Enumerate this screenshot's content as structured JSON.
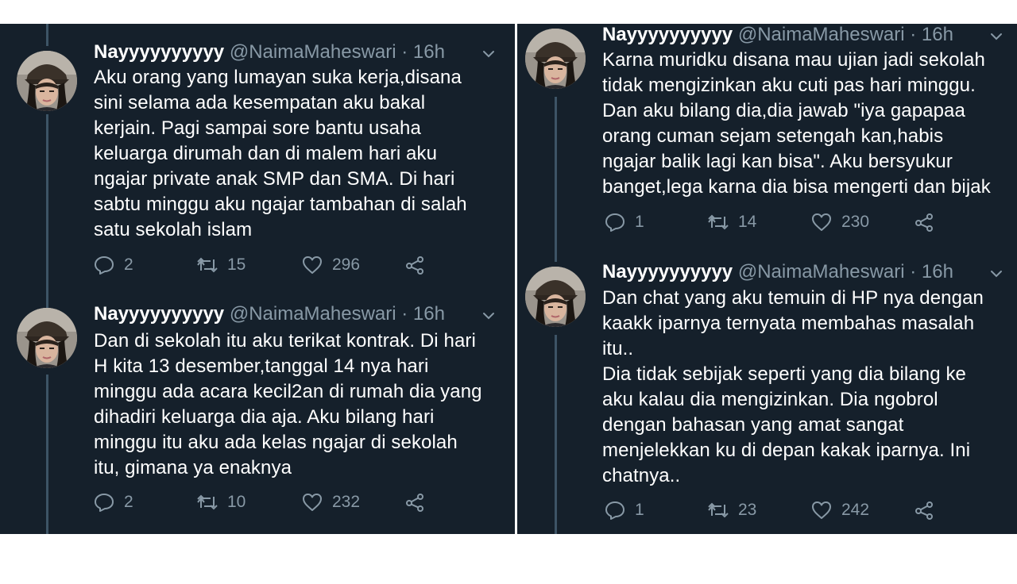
{
  "left_column": {
    "tweets": [
      {
        "name": "Nayyyyyyyyyy",
        "handle": "@NaimaMaheswari",
        "time": "· 16h",
        "text": "Aku orang yang lumayan suka kerja,disana\nsini selama ada kesempatan aku bakal\nkerjain. Pagi sampai sore bantu usaha\nkeluarga dirumah dan di malem hari aku\nngajar private anak SMP dan SMA. Di hari\nsabtu minggu aku ngajar tambahan di salah\nsatu sekolah islam",
        "replies": "2",
        "retweets": "15",
        "likes": "296"
      },
      {
        "name": "Nayyyyyyyyyy",
        "handle": "@NaimaMaheswari",
        "time": "· 16h",
        "text": "Dan di sekolah itu aku terikat kontrak. Di hari\nH kita 13 desember,tanggal 14 nya hari\nminggu ada acara kecil2an di rumah dia yang\ndihadiri keluarga dia aja. Aku bilang hari\nminggu itu aku ada kelas ngajar di sekolah\nitu, gimana ya enaknya",
        "replies": "2",
        "retweets": "10",
        "likes": "232"
      }
    ]
  },
  "right_column": {
    "tweets": [
      {
        "name": "Nayyyyyyyyyy",
        "handle": "@NaimaMaheswari",
        "time": "· 16h",
        "text": "Karna muridku disana mau ujian jadi sekolah\ntidak mengizinkan aku cuti pas hari minggu.\nDan aku bilang dia,dia jawab \"iya gapapaa\norang cuman sejam setengah kan,habis\nngajar balik lagi kan bisa\". Aku bersyukur\nbanget,lega karna dia bisa mengerti dan bijak",
        "replies": "1",
        "retweets": "14",
        "likes": "230"
      },
      {
        "name": "Nayyyyyyyyyy",
        "handle": "@NaimaMaheswari",
        "time": "· 16h",
        "text": "Dan chat yang aku temuin di HP nya dengan\nkaakk iparnya ternyata membahas masalah\nitu..\nDia tidak sebijak seperti yang dia bilang ke\naku kalau dia mengizinkan. Dia ngobrol\ndengan bahasan yang amat sangat\nmenjelekkan ku di depan kakak iparnya. Ini\nchatnya..",
        "replies": "1",
        "retweets": "23",
        "likes": "242"
      }
    ]
  },
  "colors": {
    "background": "#15202b",
    "text": "#ffffff",
    "muted": "#8899a6",
    "thread_line": "#3d5466"
  },
  "icons": [
    "avatar",
    "chevron-down-icon",
    "reply-icon",
    "retweet-icon",
    "like-icon",
    "share-icon"
  ]
}
